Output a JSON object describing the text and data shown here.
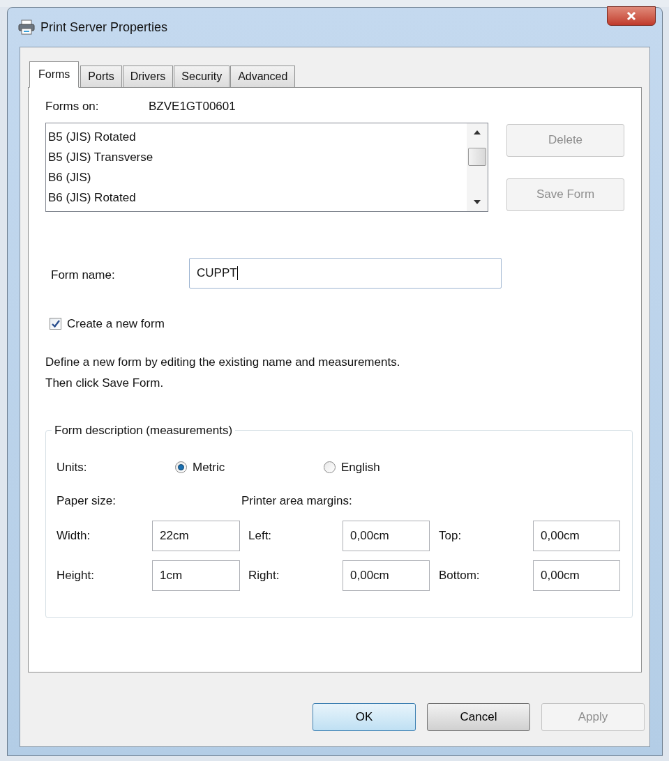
{
  "window": {
    "title": "Print Server Properties"
  },
  "tabs": [
    {
      "label": "Forms",
      "selected": true
    },
    {
      "label": "Ports",
      "selected": false
    },
    {
      "label": "Drivers",
      "selected": false
    },
    {
      "label": "Security",
      "selected": false
    },
    {
      "label": "Advanced",
      "selected": false
    }
  ],
  "forms_on": {
    "label": "Forms on:",
    "value": "BZVE1GT00601"
  },
  "forms_list": {
    "items": [
      "B5 (JIS) Rotated",
      "B5 (JIS) Transverse",
      "B6 (JIS)",
      "B6 (JIS) Rotated"
    ]
  },
  "side_buttons": [
    {
      "label": "Delete",
      "disabled": true
    },
    {
      "label": "Save Form",
      "disabled": true
    }
  ],
  "form_name": {
    "label": "Form name:",
    "value": "CUPPT"
  },
  "create_new_form": {
    "label": "Create a new form",
    "checked": true
  },
  "description": "Define a new form by editing the existing name and measurements. Then click Save Form.",
  "form_description": {
    "legend": "Form description (measurements)",
    "units": {
      "label": "Units:",
      "options": [
        {
          "label": "Metric",
          "selected": true
        },
        {
          "label": "English",
          "selected": false
        }
      ]
    },
    "paper_size_label": "Paper size:",
    "margins_label": "Printer area margins:",
    "rows": [
      [
        {
          "label": "Width:",
          "value": "22cm"
        },
        {
          "label": "Left:",
          "value": "0,00cm"
        },
        {
          "label": "Top:",
          "value": "0,00cm"
        }
      ],
      [
        {
          "label": "Height:",
          "value": "1cm"
        },
        {
          "label": "Right:",
          "value": "0,00cm"
        },
        {
          "label": "Bottom:",
          "value": "0,00cm"
        }
      ]
    ]
  },
  "dialog_buttons": [
    {
      "label": "OK",
      "default": true,
      "disabled": false
    },
    {
      "label": "Cancel",
      "default": false,
      "disabled": false
    },
    {
      "label": "Apply",
      "default": false,
      "disabled": true
    }
  ]
}
